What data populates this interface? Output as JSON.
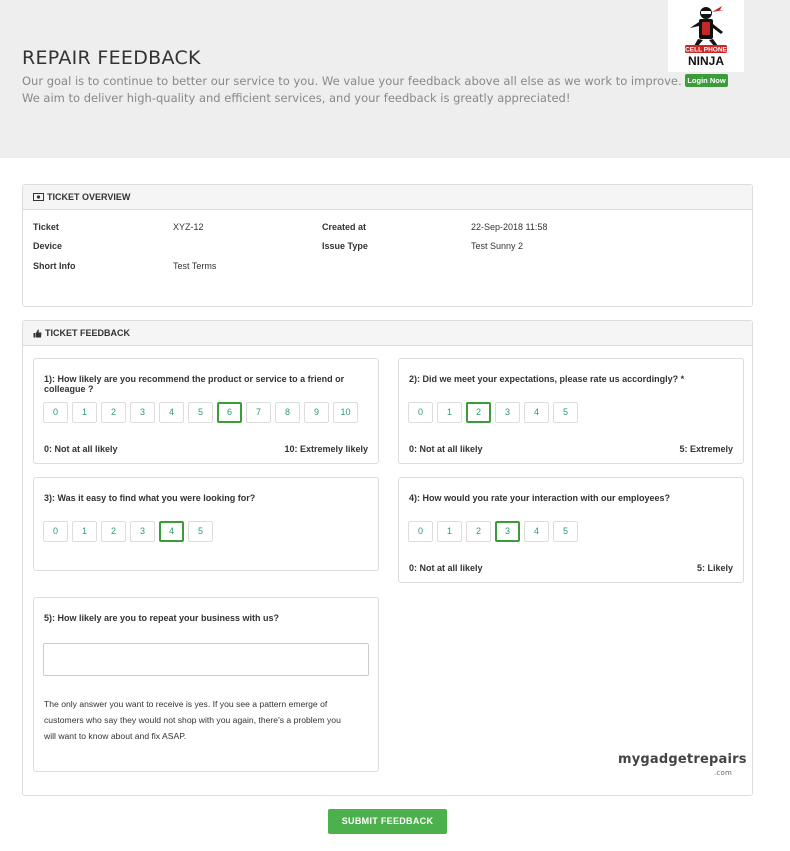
{
  "header": {
    "title": "REPAIR FEEDBACK",
    "intro_line1": "Our goal is to continue to better our service to you. We value your feedback above all else as we work to improve.",
    "intro_line2": "We aim to deliver high-quality and efficient services, and your feedback is greatly appreciated!",
    "logo_text_top": "CELL PHONE",
    "logo_text_bottom": "NINJA",
    "login_label": "Login Now"
  },
  "overview": {
    "heading": "TICKET OVERVIEW",
    "fields": {
      "ticket_label": "Ticket",
      "ticket_value": "XYZ-12",
      "device_label": "Device",
      "device_value": "",
      "short_info_label": "Short Info",
      "short_info_value": "Test Terms",
      "created_label": "Created at",
      "created_value": "22-Sep-2018 11:58",
      "issue_label": "Issue Type",
      "issue_value": "Test Sunny 2"
    }
  },
  "feedback": {
    "heading": "TICKET FEEDBACK",
    "questions": [
      {
        "text": "1): How likely are you recommend the product or service to a friend or colleague ?",
        "options": [
          "0",
          "1",
          "2",
          "3",
          "4",
          "5",
          "6",
          "7",
          "8",
          "9",
          "10"
        ],
        "selected": "6",
        "min_label": "0: Not at all likely",
        "max_label": "10: Extremely likely"
      },
      {
        "text": "2): Did we meet your expectations, please rate us accordingly? *",
        "options": [
          "0",
          "1",
          "2",
          "3",
          "4",
          "5"
        ],
        "selected": "2",
        "min_label": "0: Not at all likely",
        "max_label": "5: Extremely"
      },
      {
        "text": "3): Was it easy to find what you were looking for?",
        "options": [
          "0",
          "1",
          "2",
          "3",
          "4",
          "5"
        ],
        "selected": "4",
        "min_label": "",
        "max_label": ""
      },
      {
        "text": "4): How would you rate your interaction with our employees?",
        "options": [
          "0",
          "1",
          "2",
          "3",
          "4",
          "5"
        ],
        "selected": "3",
        "min_label": "0: Not at all likely",
        "max_label": "5: Likely"
      },
      {
        "text": "5): How likely are you to repeat your business with us?",
        "answer": "",
        "note": "The only answer you want to receive is yes. If you see a pattern emerge of customers who say they would not shop with you again, there's a problem you will want to know about and fix ASAP."
      }
    ],
    "watermark": "mygadgetrepairs",
    "watermark_suffix": ".com",
    "submit_label": "SUBMIT FEEDBACK"
  },
  "colors": {
    "accent_green": "#3a9d3a",
    "option_text": "#2e9a6b",
    "hero_bg": "#eeeeee"
  }
}
